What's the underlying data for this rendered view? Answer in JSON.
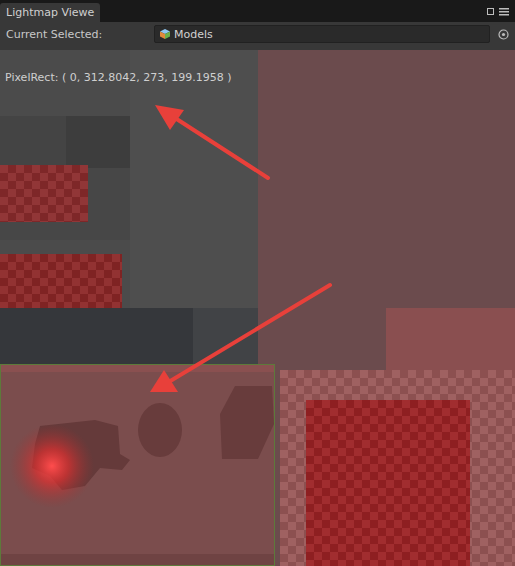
{
  "window": {
    "tabs": [
      {
        "label": "Lightmap Viewe",
        "selected": true
      }
    ]
  },
  "toolbar": {
    "label": "Current Selected:",
    "field_value": "Models"
  },
  "viewer": {
    "pixel_rect": "PixelRect: ( 0, 312.8042, 273, 199.1958 )",
    "selection": {
      "highlighted": true
    }
  }
}
